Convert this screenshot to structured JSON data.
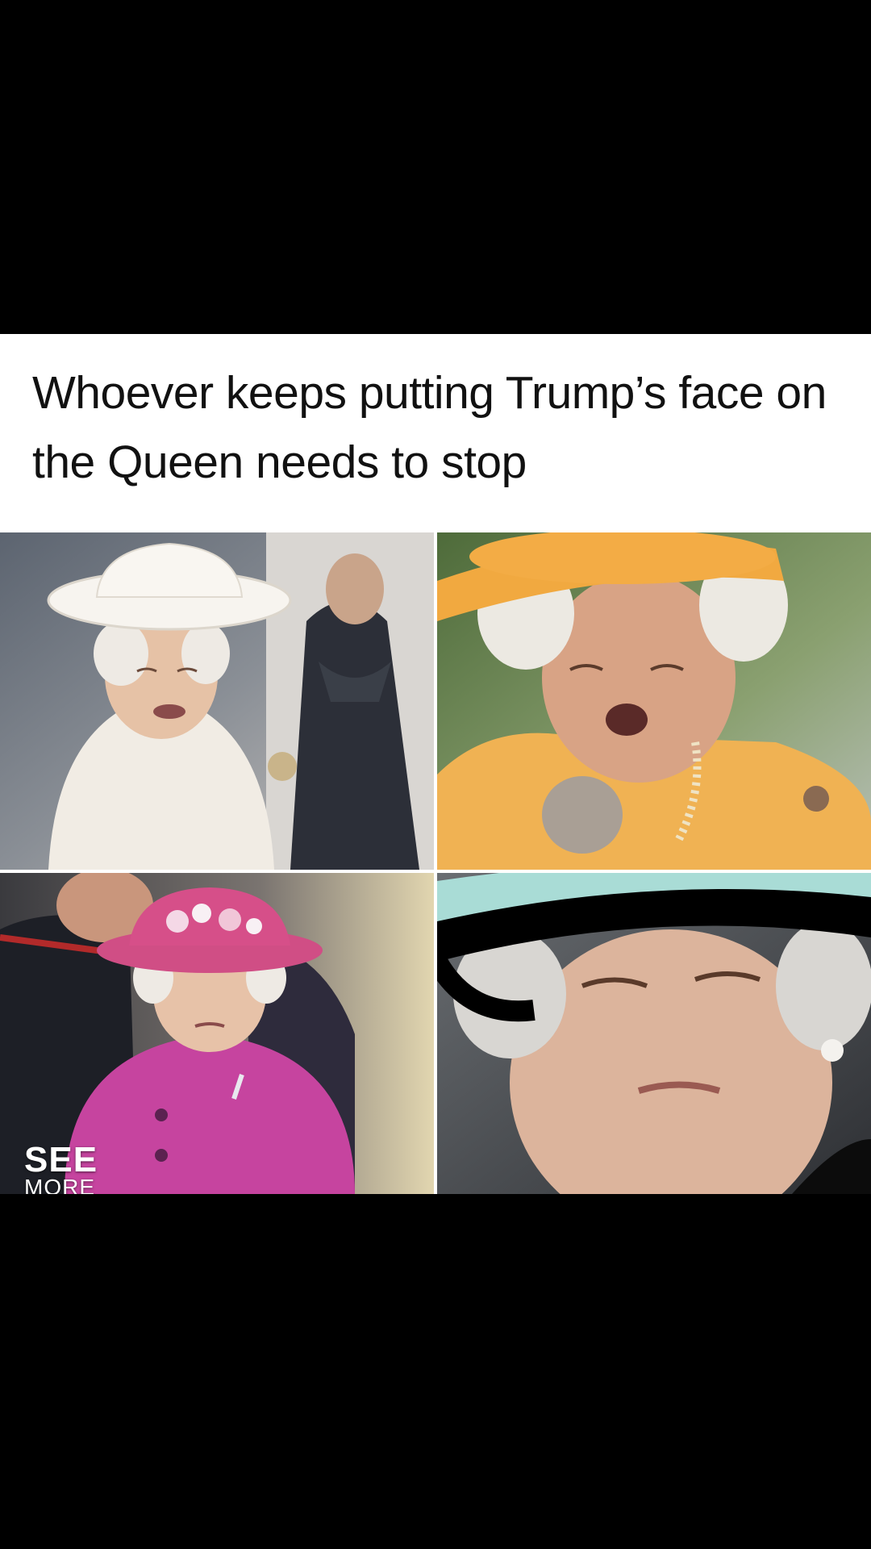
{
  "post": {
    "caption": "Whoever keeps putting Trump’s face on the Queen needs to stop",
    "panels": [
      {
        "outfit": "white hat and coat"
      },
      {
        "outfit": "yellow hat and coat"
      },
      {
        "outfit": "pink floral hat and coat"
      },
      {
        "outfit": "teal hat with black brim"
      }
    ],
    "badge": {
      "line1": "SEE",
      "line2": "MORE"
    }
  },
  "colors": {
    "background": "#000000",
    "meme_background": "#ffffff",
    "caption_text": "#111111"
  }
}
